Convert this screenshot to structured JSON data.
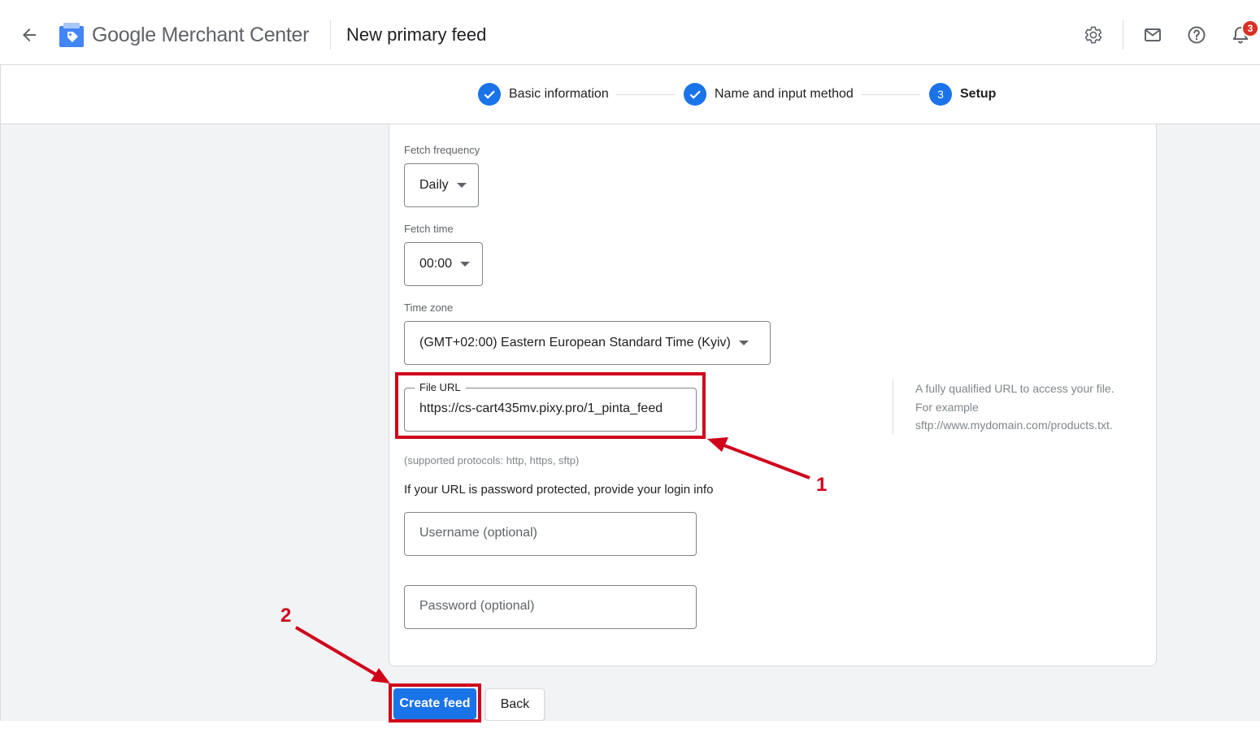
{
  "header": {
    "brand_google": "Google",
    "brand_product": "Merchant Center",
    "page_title": "New primary feed",
    "notification_count": "3"
  },
  "stepper": {
    "steps": [
      {
        "label": "Basic information",
        "state": "done"
      },
      {
        "label": "Name and input method",
        "state": "done"
      },
      {
        "label": "Setup",
        "state": "active",
        "number": "3"
      }
    ]
  },
  "form": {
    "fetch_frequency": {
      "label": "Fetch frequency",
      "value": "Daily"
    },
    "fetch_time": {
      "label": "Fetch time",
      "value": "00:00"
    },
    "time_zone": {
      "label": "Time zone",
      "value": "(GMT+02:00) Eastern European Standard Time (Kyiv)"
    },
    "file_url": {
      "label": "File URL",
      "value": "https://cs-cart435mv.pixy.pro/1_pinta_feed"
    },
    "file_url_help": [
      "A fully qualified URL to access your file.",
      "For example",
      "sftp://www.mydomain.com/products.txt."
    ],
    "protocols_note": "(supported protocols: http, https, sftp)",
    "login_info": "If your URL is password protected, provide your login info",
    "username_placeholder": "Username (optional)",
    "password_placeholder": "Password (optional)"
  },
  "actions": {
    "create_label": "Create feed",
    "back_label": "Back"
  },
  "annotations": {
    "marker_1": "1",
    "marker_2": "2"
  },
  "colors": {
    "accent": "#1a73e8",
    "annotation_red": "#d0021b",
    "badge_red": "#d93025"
  }
}
